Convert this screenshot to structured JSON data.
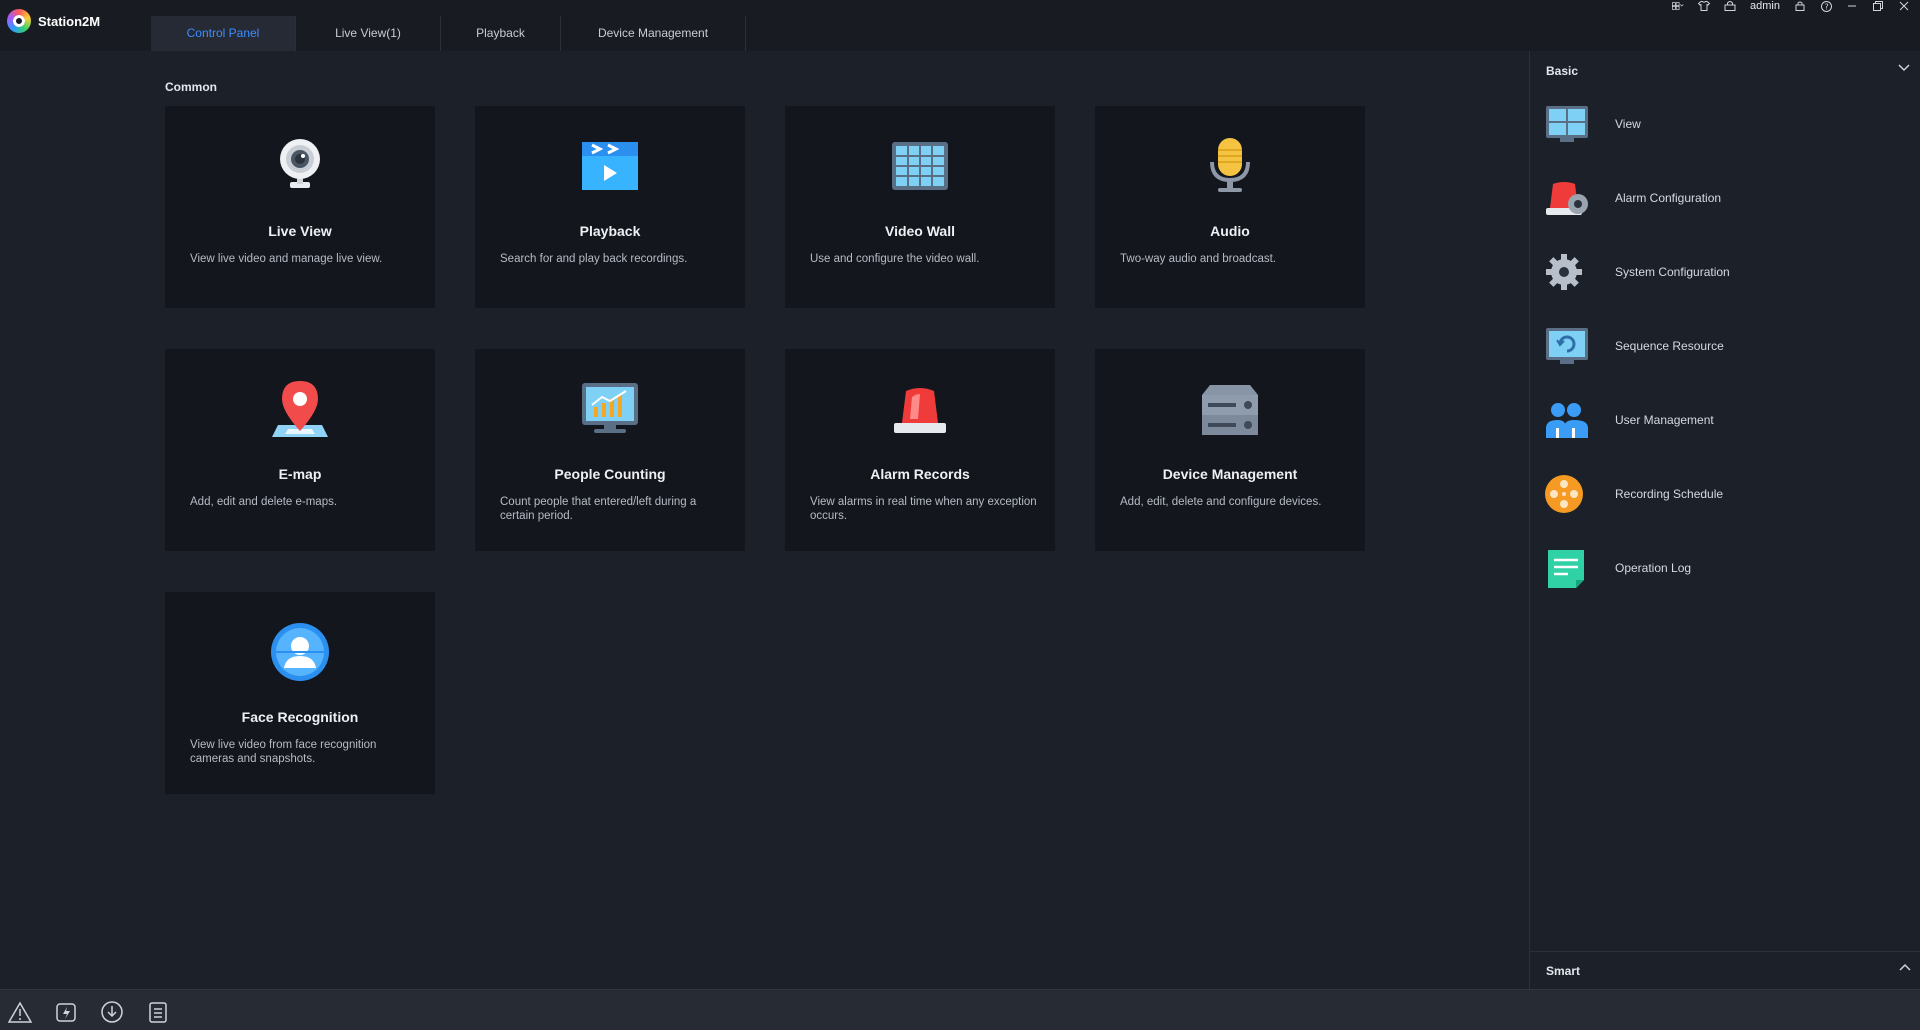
{
  "app": {
    "title": "Station2M"
  },
  "tabs": [
    {
      "label": "Control Panel",
      "active": true
    },
    {
      "label": "Live View(1)",
      "active": false
    },
    {
      "label": "Playback",
      "active": false
    },
    {
      "label": "Device Management",
      "active": false
    }
  ],
  "system": {
    "user": "admin"
  },
  "main": {
    "section_label": "Common",
    "cards": [
      {
        "title": "Live View",
        "desc": "View live video and manage live view.",
        "icon": "webcam-icon"
      },
      {
        "title": "Playback",
        "desc": "Search for and play back recordings.",
        "icon": "clapperboard-icon"
      },
      {
        "title": "Video Wall",
        "desc": "Use and configure the video wall.",
        "icon": "video-wall-icon"
      },
      {
        "title": "Audio",
        "desc": "Two-way audio and broadcast.",
        "icon": "microphone-icon"
      },
      {
        "title": "E-map",
        "desc": "Add, edit and delete e-maps.",
        "icon": "map-pin-icon"
      },
      {
        "title": "People Counting",
        "desc": "Count people that entered/left during a certain period.",
        "icon": "chart-monitor-icon"
      },
      {
        "title": "Alarm Records",
        "desc": "View alarms in real time when any exception occurs.",
        "icon": "alarm-light-icon"
      },
      {
        "title": "Device Management",
        "desc": "Add, edit, delete and configure devices.",
        "icon": "server-icon"
      },
      {
        "title": "Face Recognition",
        "desc": "View live video from face recognition cameras and snapshots.",
        "icon": "face-recognition-icon"
      }
    ]
  },
  "rpanel": {
    "heading": "Basic",
    "items": [
      {
        "label": "View",
        "icon": "view-monitor-icon"
      },
      {
        "label": "Alarm Configuration",
        "icon": "alarm-gear-icon"
      },
      {
        "label": "System Configuration",
        "icon": "gear-icon"
      },
      {
        "label": "Sequence Resource",
        "icon": "sequence-monitor-icon"
      },
      {
        "label": "User Management",
        "icon": "users-icon"
      },
      {
        "label": "Recording Schedule",
        "icon": "film-reel-icon"
      },
      {
        "label": "Operation Log",
        "icon": "log-document-icon"
      }
    ],
    "footer": "Smart"
  },
  "colors": {
    "accent": "#3d8eff",
    "background": "#1c2029",
    "card": "#13161d"
  }
}
